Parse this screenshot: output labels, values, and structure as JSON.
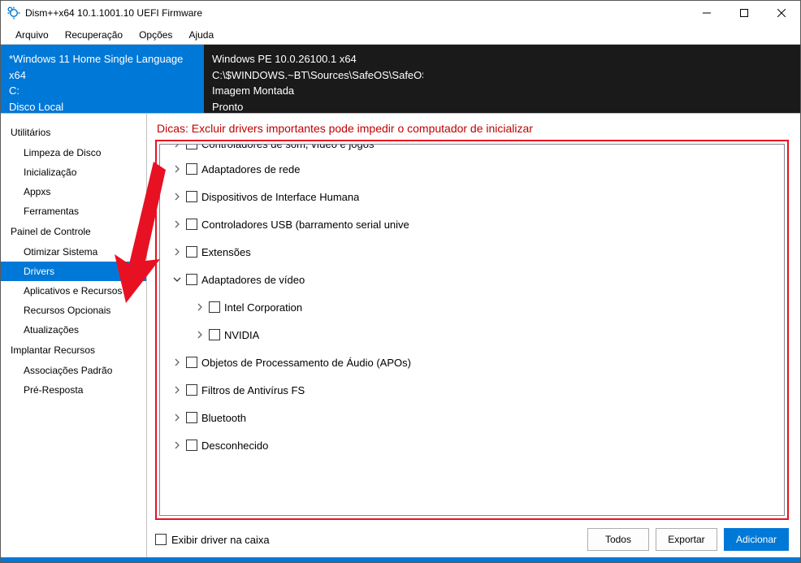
{
  "window": {
    "title": "Dism++x64 10.1.1001.10 UEFI Firmware"
  },
  "menu": [
    "Arquivo",
    "Recuperação",
    "Opções",
    "Ajuda"
  ],
  "os_panels": {
    "active": {
      "line1": "*Windows 11 Home Single Language x64",
      "line2": "C:",
      "line3": "Disco Local",
      "line4": "Pronto"
    },
    "inactive": {
      "line1": "Windows PE 10.0.26100.1 x64",
      "line2": "C:\\$WINDOWS.~BT\\Sources\\SafeOS\\SafeOS.Mount",
      "line3": "Imagem Montada",
      "line4": "Pronto"
    }
  },
  "sidebar": {
    "groups": [
      {
        "header": "Utilitários",
        "items": [
          {
            "label": "Limpeza de Disco",
            "selected": false
          },
          {
            "label": "Inicialização",
            "selected": false
          },
          {
            "label": "Appxs",
            "selected": false
          },
          {
            "label": "Ferramentas",
            "selected": false
          }
        ]
      },
      {
        "header": "Painel de Controle",
        "items": [
          {
            "label": "Otimizar Sistema",
            "selected": false
          },
          {
            "label": "Drivers",
            "selected": true
          },
          {
            "label": "Aplicativos e Recursos",
            "selected": false
          },
          {
            "label": "Recursos Opcionais",
            "selected": false
          },
          {
            "label": "Atualizações",
            "selected": false
          }
        ]
      },
      {
        "header": "Implantar Recursos",
        "items": [
          {
            "label": "Associações Padrão",
            "selected": false
          },
          {
            "label": "Pré-Resposta",
            "selected": false
          }
        ]
      }
    ]
  },
  "content": {
    "tip": "Dicas: Excluir drivers importantes pode impedir o computador de inicializar",
    "tree": [
      {
        "indent": 0,
        "expander": "collapsed",
        "label": "Controladores de som, vídeo e jogos",
        "cut": true
      },
      {
        "indent": 0,
        "expander": "collapsed",
        "label": "Adaptadores de rede"
      },
      {
        "indent": 0,
        "expander": "collapsed",
        "label": "Dispositivos de Interface Humana"
      },
      {
        "indent": 0,
        "expander": "collapsed",
        "label": "Controladores USB (barramento serial unive"
      },
      {
        "indent": 0,
        "expander": "collapsed",
        "label": "Extensões"
      },
      {
        "indent": 0,
        "expander": "expanded",
        "label": "Adaptadores de vídeo"
      },
      {
        "indent": 1,
        "expander": "collapsed",
        "label": "Intel Corporation"
      },
      {
        "indent": 1,
        "expander": "collapsed",
        "label": "NVIDIA"
      },
      {
        "indent": 0,
        "expander": "collapsed",
        "label": "Objetos de Processamento de Áudio (APOs)"
      },
      {
        "indent": 0,
        "expander": "collapsed",
        "label": "Filtros de Antivírus FS"
      },
      {
        "indent": 0,
        "expander": "collapsed",
        "label": "Bluetooth"
      },
      {
        "indent": 0,
        "expander": "collapsed",
        "label": "Desconhecido"
      }
    ],
    "show_in_box_label": "Exibir driver na caixa",
    "buttons": {
      "all": "Todos",
      "export": "Exportar",
      "add": "Adicionar"
    }
  }
}
